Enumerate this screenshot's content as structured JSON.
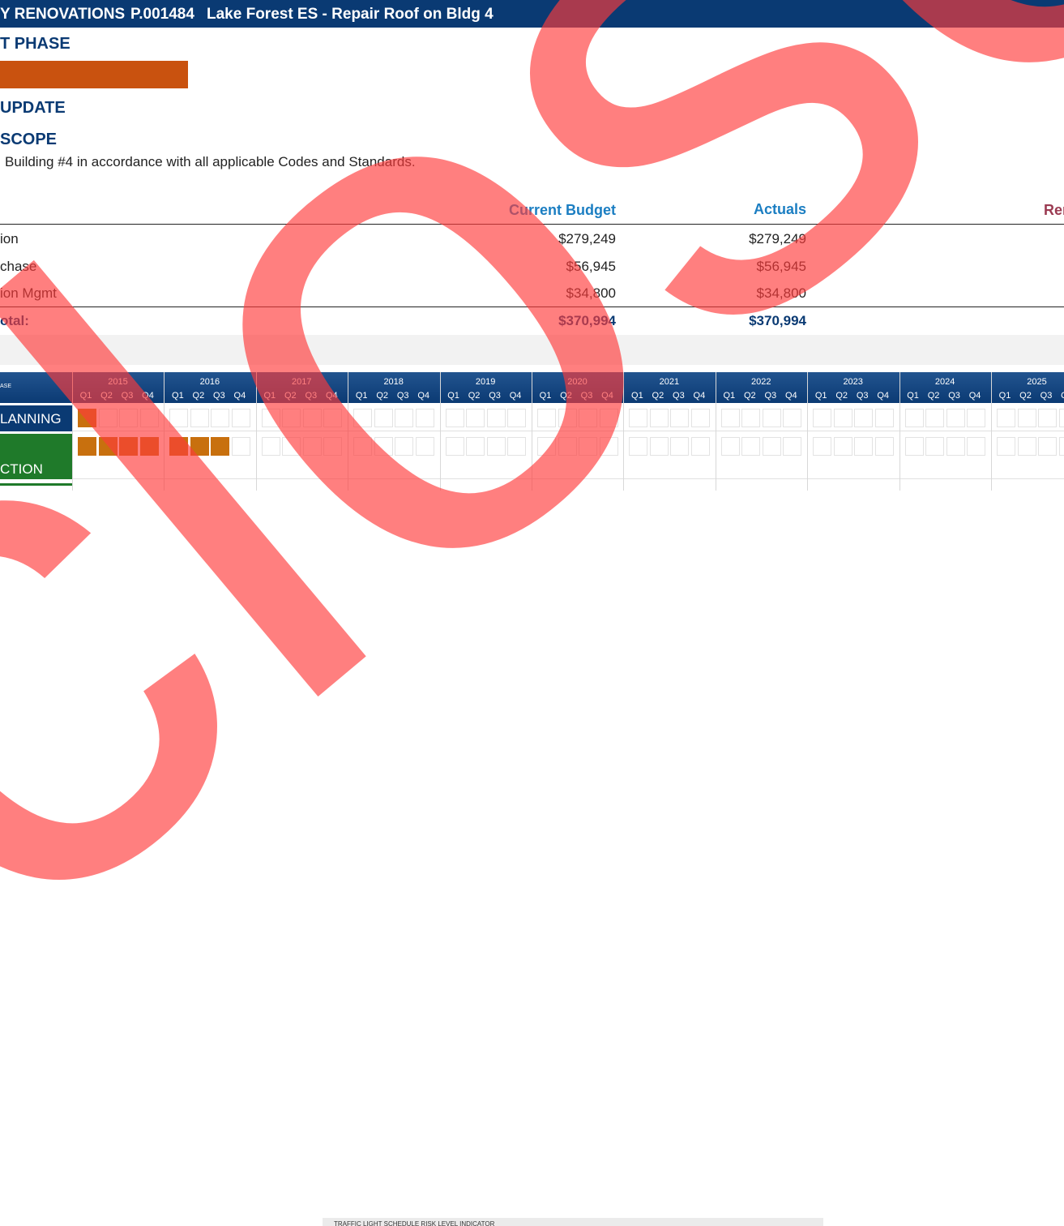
{
  "header": {
    "program": "Y RENOVATIONS",
    "project_id": "P.001484",
    "project_name": "Lake Forest ES - Repair Roof on Bldg 4"
  },
  "sections": {
    "phase_title": "T PHASE",
    "update_title": "UPDATE",
    "scope_title": "SCOPE",
    "scope_text": "Building #4 in accordance with all applicable Codes and Standards."
  },
  "budget": {
    "columns": {
      "budget": "Current Budget",
      "actuals": "Actuals",
      "remaining": "Rer"
    },
    "rows": [
      {
        "label": "ion",
        "budget": "$279,249",
        "actuals": "$279,249"
      },
      {
        "label": "chase",
        "budget": "$56,945",
        "actuals": "$56,945"
      },
      {
        "label": "ion Mgmt",
        "budget": "$34,800",
        "actuals": "$34,800"
      }
    ],
    "total": {
      "label": "otal:",
      "budget": "$370,994",
      "actuals": "$370,994"
    }
  },
  "gantt": {
    "phase_col": "ASE",
    "years": [
      "2015",
      "2016",
      "2017",
      "2018",
      "2019",
      "2020",
      "2021",
      "2022",
      "2023",
      "2024",
      "2025"
    ],
    "quarters": [
      "Q1",
      "Q2",
      "Q3",
      "Q4"
    ],
    "phases": [
      {
        "label": "LANNING",
        "color": "#0a3a73",
        "active": [
          [
            0,
            0
          ]
        ]
      },
      {
        "label": "CTION",
        "color": "#1f7a2a",
        "active": [
          [
            0,
            0
          ],
          [
            0,
            1
          ],
          [
            0,
            2
          ],
          [
            0,
            3
          ],
          [
            1,
            0
          ],
          [
            1,
            1
          ],
          [
            1,
            2
          ]
        ]
      }
    ],
    "bar_color": "#c8700e"
  },
  "legend": {
    "text": "TRAFFIC LIGHT SCHEDULE RISK LEVEL INDICATOR"
  },
  "watermark": {
    "text": "closed",
    "color": "#ff3b3b"
  }
}
